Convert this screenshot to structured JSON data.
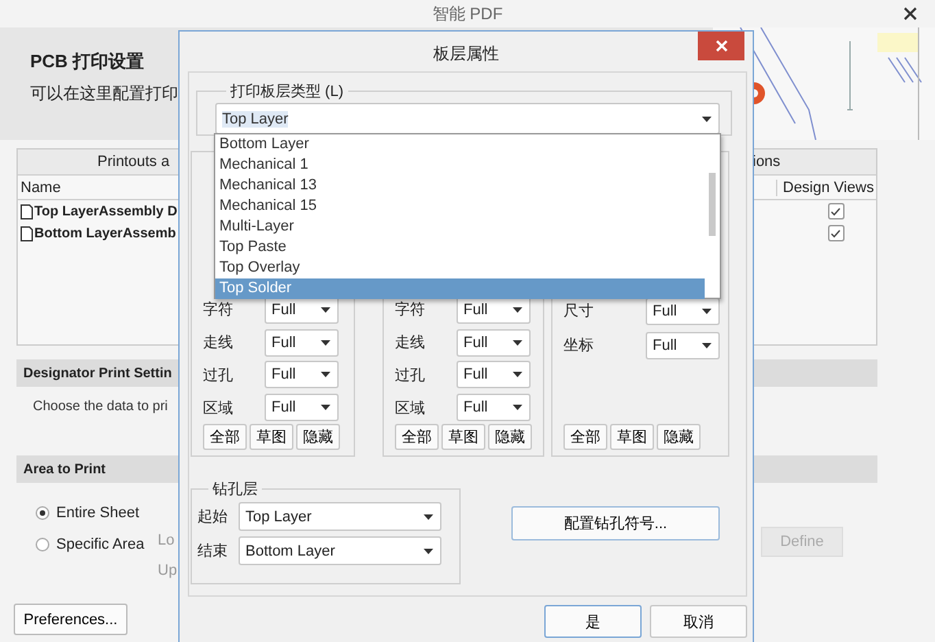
{
  "window": {
    "title": "智能 PDF"
  },
  "header": {
    "title": "PCB 打印设置",
    "subtitle": "可以在这里配置打印"
  },
  "printouts": {
    "heading": "Printouts a",
    "options_heading": "ions",
    "name_column": "Name",
    "design_views_column": "Design Views",
    "rows": [
      {
        "name": "Top LayerAssembly D",
        "design_view": true
      },
      {
        "name": "Bottom LayerAssemb",
        "design_view": true
      }
    ]
  },
  "designator": {
    "heading": "Designator Print Settin",
    "text": "Choose the data to pri"
  },
  "area": {
    "heading": "Area to Print",
    "options": [
      {
        "label": "Entire Sheet",
        "selected": true
      },
      {
        "label": "Specific Area",
        "selected": false
      }
    ],
    "lower_label": "Lo",
    "upper_label": "Up",
    "define_button": {
      "label": "Define",
      "disabled": true
    }
  },
  "preferences_button": "Preferences...",
  "dialog": {
    "title": "板层属性",
    "layer_type": {
      "label": "打印板层类型 (L)",
      "value": "Top Layer",
      "options": [
        {
          "label": "Bottom Layer",
          "selected": false
        },
        {
          "label": "Mechanical 1",
          "selected": false
        },
        {
          "label": "Mechanical 13",
          "selected": false
        },
        {
          "label": "Mechanical 15",
          "selected": false
        },
        {
          "label": "Multi-Layer",
          "selected": false
        },
        {
          "label": "Top Paste",
          "selected": false
        },
        {
          "label": "Top Overlay",
          "selected": false
        },
        {
          "label": "Top Solder",
          "selected": true
        }
      ]
    },
    "groups": [
      {
        "rows": [
          {
            "label": "字符",
            "value": "Full"
          },
          {
            "label": "走线",
            "value": "Full"
          },
          {
            "label": "过孔",
            "value": "Full"
          },
          {
            "label": "区域",
            "value": "Full"
          }
        ],
        "buttons": [
          "全部",
          "草图",
          "隐藏"
        ]
      },
      {
        "rows": [
          {
            "label": "字符",
            "value": "Full"
          },
          {
            "label": "走线",
            "value": "Full"
          },
          {
            "label": "过孔",
            "value": "Full"
          },
          {
            "label": "区域",
            "value": "Full"
          }
        ],
        "buttons": [
          "全部",
          "草图",
          "隐藏"
        ]
      },
      {
        "rows": [
          {
            "label": "尺寸",
            "value": "Full"
          },
          {
            "label": "坐标",
            "value": "Full"
          }
        ],
        "buttons": [
          "全部",
          "草图",
          "隐藏"
        ]
      }
    ],
    "drill": {
      "label": "钻孔层",
      "start_label": "起始",
      "start_value": "Top Layer",
      "end_label": "结束",
      "end_value": "Bottom Layer"
    },
    "drill_symbol_button": "配置钻孔符号...",
    "buttons": [
      {
        "label": "是",
        "default": true
      },
      {
        "label": "取消",
        "default": false
      }
    ]
  }
}
